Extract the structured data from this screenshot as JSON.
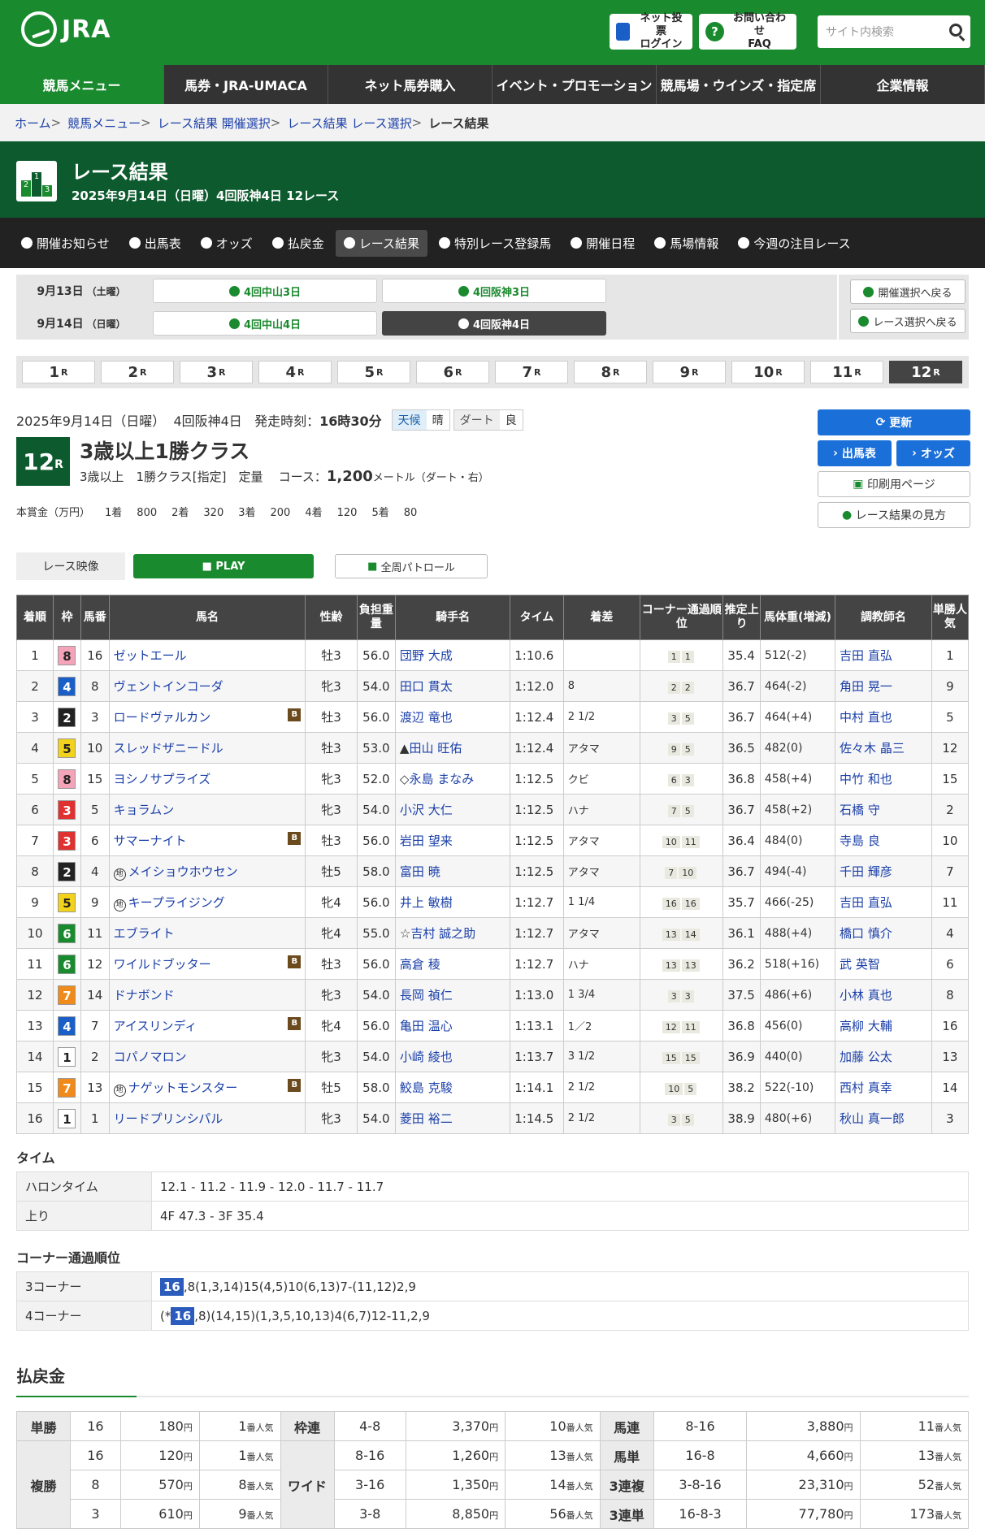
{
  "header": {
    "logo": "JRA",
    "login": [
      "ネット投票",
      "ログイン"
    ],
    "faq": [
      "お問い合わせ",
      "FAQ"
    ],
    "search_placeholder": "サイト内検索"
  },
  "gnav": [
    "競馬メニュー",
    "馬券・JRA-UMACA",
    "ネット馬券購入",
    "イベント・プロモーション",
    "競馬場・ウインズ・指定席",
    "企業情報"
  ],
  "breadcrumb": [
    "ホーム",
    "競馬メニュー",
    "レース結果 開催選択",
    "レース結果 レース選択",
    "レース結果"
  ],
  "title": {
    "main": "レース結果",
    "sub": "2025年9月14日（日曜）4回阪神4日 12レース",
    "icon": [
      "2",
      "1",
      "3"
    ]
  },
  "tabs": [
    "開催お知らせ",
    "出馬表",
    "オッズ",
    "払戻金",
    "レース結果",
    "特別レース登録馬",
    "開催日程",
    "馬場情報",
    "今週の注目レース"
  ],
  "days": [
    {
      "label": "9月13日",
      "dow": "（土曜）",
      "meets": [
        "4回中山3日",
        "4回阪神3日"
      ]
    },
    {
      "label": "9月14日",
      "dow": "（日曜）",
      "meets": [
        "4回中山4日",
        "4回阪神4日"
      ]
    }
  ],
  "side_buttons": [
    "開催選択へ戻る",
    "レース選択へ戻る"
  ],
  "races": [
    "1",
    "2",
    "3",
    "4",
    "5",
    "6",
    "7",
    "8",
    "9",
    "10",
    "11",
    "12"
  ],
  "race_suffix": "R",
  "race": {
    "date": "2025年9月14日（日曜）",
    "meet": "4回阪神4日",
    "start_label": "発走時刻：",
    "start": "16時30分",
    "weather_k": "天候",
    "weather": "晴",
    "track_k": "ダート",
    "track": "良",
    "num": "12",
    "num_suffix": "R",
    "name": "3歳以上1勝クラス",
    "cond": "3歳以上　1勝クラス[指定]　定量",
    "course_label": "コース：",
    "course": "1,200",
    "course_unit": "メートル（ダート・右）"
  },
  "prize": {
    "label": "本賞金（万円）",
    "items": [
      "1着",
      "800",
      "2着",
      "320",
      "3着",
      "200",
      "4着",
      "120",
      "5着",
      "80"
    ]
  },
  "right_buttons": {
    "update": "更新",
    "entries": "出馬表",
    "odds": "オッズ",
    "print": "印刷用ページ",
    "guide": "レース結果の見方"
  },
  "video": {
    "label": "レース映像",
    "play": "PLAY",
    "patrol": "全周パトロール"
  },
  "table_headers": [
    "着順",
    "枠",
    "馬番",
    "馬名",
    "性齢",
    "負担重量",
    "騎手名",
    "タイム",
    "着差",
    "コーナー通過順位",
    "推定上り",
    "馬体重(増減)",
    "調教師名",
    "単勝人気"
  ],
  "frame_colors": {
    "1": "#ffffff",
    "2": "#222222",
    "3": "#e03030",
    "4": "#1a5fc8",
    "5": "#f2d21a",
    "6": "#1a8a2e",
    "7": "#f08a1a",
    "8": "#f4a3b8"
  },
  "rows": [
    [
      "1",
      "8",
      "16",
      "ゼットエール",
      "",
      "牡3",
      "56.0",
      "",
      "団野 大成",
      "1:10.6",
      "",
      "1",
      "1",
      "35.4",
      "512(-2)",
      "吉田 直弘",
      "1"
    ],
    [
      "2",
      "4",
      "8",
      "ヴェントインコーダ",
      "",
      "牝3",
      "54.0",
      "",
      "田口 貫太",
      "1:12.0",
      "8",
      "2",
      "2",
      "36.7",
      "464(-2)",
      "角田 晃一",
      "9"
    ],
    [
      "3",
      "2",
      "3",
      "ロードヴァルカン",
      "B",
      "牡3",
      "56.0",
      "",
      "渡辺 竜也",
      "1:12.4",
      "2 1/2",
      "3",
      "5",
      "36.7",
      "464(+4)",
      "中村 直也",
      "5"
    ],
    [
      "4",
      "5",
      "10",
      "スレッドザニードル",
      "",
      "牡3",
      "53.0",
      "▲",
      "田山 旺佑",
      "1:12.4",
      "アタマ",
      "9",
      "5",
      "36.5",
      "482(0)",
      "佐々木 晶三",
      "12"
    ],
    [
      "5",
      "8",
      "15",
      "ヨシノサプライズ",
      "",
      "牝3",
      "52.0",
      "◇",
      "永島 まなみ",
      "1:12.5",
      "クビ",
      "6",
      "3",
      "36.8",
      "458(+4)",
      "中竹 和也",
      "15"
    ],
    [
      "6",
      "3",
      "5",
      "キョラムン",
      "",
      "牝3",
      "54.0",
      "",
      "小沢 大仁",
      "1:12.5",
      "ハナ",
      "7",
      "5",
      "36.7",
      "458(+2)",
      "石橋 守",
      "2"
    ],
    [
      "7",
      "3",
      "6",
      "サマーナイト",
      "B",
      "牡3",
      "56.0",
      "",
      "岩田 望来",
      "1:12.5",
      "アタマ",
      "10",
      "11",
      "36.4",
      "484(0)",
      "寺島 良",
      "10"
    ],
    [
      "8",
      "2",
      "4",
      "メイショウホウセン",
      "地",
      "牡5",
      "58.0",
      "",
      "富田 暁",
      "1:12.5",
      "アタマ",
      "7",
      "10",
      "36.7",
      "494(-4)",
      "千田 輝彦",
      "7"
    ],
    [
      "9",
      "5",
      "9",
      "キープライジング",
      "地",
      "牝4",
      "56.0",
      "",
      "井上 敏樹",
      "1:12.7",
      "1 1/4",
      "16",
      "16",
      "35.7",
      "466(-25)",
      "吉田 直弘",
      "11"
    ],
    [
      "10",
      "6",
      "11",
      "エブライト",
      "",
      "牝4",
      "55.0",
      "☆",
      "吉村 誠之助",
      "1:12.7",
      "アタマ",
      "13",
      "14",
      "36.1",
      "488(+4)",
      "橋口 慎介",
      "4"
    ],
    [
      "11",
      "6",
      "12",
      "ワイルドブッター",
      "B",
      "牡3",
      "56.0",
      "",
      "高倉 稜",
      "1:12.7",
      "ハナ",
      "13",
      "13",
      "36.2",
      "518(+16)",
      "武 英智",
      "6"
    ],
    [
      "12",
      "7",
      "14",
      "ドナボンド",
      "",
      "牝3",
      "54.0",
      "",
      "長岡 禎仁",
      "1:13.0",
      "1 3/4",
      "3",
      "3",
      "37.5",
      "486(+6)",
      "小林 真也",
      "8"
    ],
    [
      "13",
      "4",
      "7",
      "アイスリンディ",
      "B",
      "牝4",
      "56.0",
      "",
      "亀田 温心",
      "1:13.1",
      "1／2",
      "12",
      "11",
      "36.8",
      "456(0)",
      "高柳 大輔",
      "16"
    ],
    [
      "14",
      "1",
      "2",
      "コパノマロン",
      "",
      "牝3",
      "54.0",
      "",
      "小崎 綾也",
      "1:13.7",
      "3 1/2",
      "15",
      "15",
      "36.9",
      "440(0)",
      "加藤 公太",
      "13"
    ],
    [
      "15",
      "7",
      "13",
      "ナゲットモンスター",
      "B地",
      "牡5",
      "58.0",
      "",
      "鮫島 克駿",
      "1:14.1",
      "2 1/2",
      "10",
      "5",
      "38.2",
      "522(-10)",
      "西村 真幸",
      "14"
    ],
    [
      "16",
      "1",
      "1",
      "リードプリンシパル",
      "",
      "牝3",
      "54.0",
      "",
      "菱田 裕二",
      "1:14.5",
      "2 1/2",
      "3",
      "5",
      "38.9",
      "480(+6)",
      "秋山 真一郎",
      "3"
    ]
  ],
  "time": {
    "heading": "タイム",
    "furlong_label": "ハロンタイム",
    "furlong": "12.1 - 11.2 - 11.9 - 12.0 - 11.7 - 11.7",
    "last_label": "上り",
    "last": "4F 47.3 - 3F 35.4"
  },
  "corner": {
    "heading": "コーナー通過順位",
    "c3_label": "3コーナー",
    "c3_hl": "16",
    "c3": ",8(1,3,14)15(4,5)10(6,13)7-(11,12)2,9",
    "c4_label": "4コーナー",
    "c4_pre": "(*",
    "c4_hl": "16",
    "c4": ",8)(14,15)(1,3,5,10,13)4(6,7)12-11,2,9"
  },
  "payout": {
    "heading": "払戻金",
    "yen": "円",
    "pop": "番人気",
    "rows": [
      {
        "t1": "単勝",
        "a1": "16",
        "y1": "180",
        "p1": "1",
        "t2": "枠連",
        "a2": "4-8",
        "y2": "3,370",
        "p2": "10",
        "t3": "馬連",
        "a3": "8-16",
        "y3": "3,880",
        "p3": "11"
      },
      {
        "t1": "複勝",
        "a1": "16",
        "y1": "120",
        "p1": "1",
        "t2": "ワイド",
        "a2": "8-16",
        "y2": "1,260",
        "p2": "13",
        "t3": "馬単",
        "a3": "16-8",
        "y3": "4,660",
        "p3": "13"
      },
      {
        "t1": "",
        "a1": "8",
        "y1": "570",
        "p1": "8",
        "t2": "",
        "a2": "3-16",
        "y2": "1,350",
        "p2": "14",
        "t3": "3連複",
        "a3": "3-8-16",
        "y3": "23,310",
        "p3": "52"
      },
      {
        "t1": "",
        "a1": "3",
        "y1": "610",
        "p1": "9",
        "t2": "",
        "a2": "3-8",
        "y2": "8,850",
        "p2": "56",
        "t3": "3連単",
        "a3": "16-8-3",
        "y3": "77,780",
        "p3": "173"
      }
    ]
  }
}
